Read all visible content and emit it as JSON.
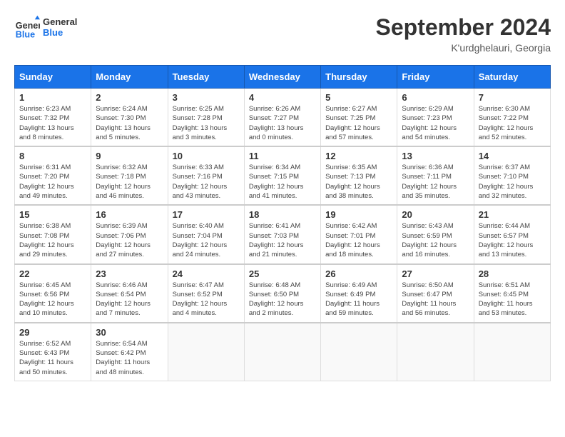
{
  "header": {
    "logo_line1": "General",
    "logo_line2": "Blue",
    "month": "September 2024",
    "location": "K'urdghelauri, Georgia"
  },
  "columns": [
    "Sunday",
    "Monday",
    "Tuesday",
    "Wednesday",
    "Thursday",
    "Friday",
    "Saturday"
  ],
  "weeks": [
    [
      {
        "day": "1",
        "info": "Sunrise: 6:23 AM\nSunset: 7:32 PM\nDaylight: 13 hours\nand 8 minutes."
      },
      {
        "day": "2",
        "info": "Sunrise: 6:24 AM\nSunset: 7:30 PM\nDaylight: 13 hours\nand 5 minutes."
      },
      {
        "day": "3",
        "info": "Sunrise: 6:25 AM\nSunset: 7:28 PM\nDaylight: 13 hours\nand 3 minutes."
      },
      {
        "day": "4",
        "info": "Sunrise: 6:26 AM\nSunset: 7:27 PM\nDaylight: 13 hours\nand 0 minutes."
      },
      {
        "day": "5",
        "info": "Sunrise: 6:27 AM\nSunset: 7:25 PM\nDaylight: 12 hours\nand 57 minutes."
      },
      {
        "day": "6",
        "info": "Sunrise: 6:29 AM\nSunset: 7:23 PM\nDaylight: 12 hours\nand 54 minutes."
      },
      {
        "day": "7",
        "info": "Sunrise: 6:30 AM\nSunset: 7:22 PM\nDaylight: 12 hours\nand 52 minutes."
      }
    ],
    [
      {
        "day": "8",
        "info": "Sunrise: 6:31 AM\nSunset: 7:20 PM\nDaylight: 12 hours\nand 49 minutes."
      },
      {
        "day": "9",
        "info": "Sunrise: 6:32 AM\nSunset: 7:18 PM\nDaylight: 12 hours\nand 46 minutes."
      },
      {
        "day": "10",
        "info": "Sunrise: 6:33 AM\nSunset: 7:16 PM\nDaylight: 12 hours\nand 43 minutes."
      },
      {
        "day": "11",
        "info": "Sunrise: 6:34 AM\nSunset: 7:15 PM\nDaylight: 12 hours\nand 41 minutes."
      },
      {
        "day": "12",
        "info": "Sunrise: 6:35 AM\nSunset: 7:13 PM\nDaylight: 12 hours\nand 38 minutes."
      },
      {
        "day": "13",
        "info": "Sunrise: 6:36 AM\nSunset: 7:11 PM\nDaylight: 12 hours\nand 35 minutes."
      },
      {
        "day": "14",
        "info": "Sunrise: 6:37 AM\nSunset: 7:10 PM\nDaylight: 12 hours\nand 32 minutes."
      }
    ],
    [
      {
        "day": "15",
        "info": "Sunrise: 6:38 AM\nSunset: 7:08 PM\nDaylight: 12 hours\nand 29 minutes."
      },
      {
        "day": "16",
        "info": "Sunrise: 6:39 AM\nSunset: 7:06 PM\nDaylight: 12 hours\nand 27 minutes."
      },
      {
        "day": "17",
        "info": "Sunrise: 6:40 AM\nSunset: 7:04 PM\nDaylight: 12 hours\nand 24 minutes."
      },
      {
        "day": "18",
        "info": "Sunrise: 6:41 AM\nSunset: 7:03 PM\nDaylight: 12 hours\nand 21 minutes."
      },
      {
        "day": "19",
        "info": "Sunrise: 6:42 AM\nSunset: 7:01 PM\nDaylight: 12 hours\nand 18 minutes."
      },
      {
        "day": "20",
        "info": "Sunrise: 6:43 AM\nSunset: 6:59 PM\nDaylight: 12 hours\nand 16 minutes."
      },
      {
        "day": "21",
        "info": "Sunrise: 6:44 AM\nSunset: 6:57 PM\nDaylight: 12 hours\nand 13 minutes."
      }
    ],
    [
      {
        "day": "22",
        "info": "Sunrise: 6:45 AM\nSunset: 6:56 PM\nDaylight: 12 hours\nand 10 minutes."
      },
      {
        "day": "23",
        "info": "Sunrise: 6:46 AM\nSunset: 6:54 PM\nDaylight: 12 hours\nand 7 minutes."
      },
      {
        "day": "24",
        "info": "Sunrise: 6:47 AM\nSunset: 6:52 PM\nDaylight: 12 hours\nand 4 minutes."
      },
      {
        "day": "25",
        "info": "Sunrise: 6:48 AM\nSunset: 6:50 PM\nDaylight: 12 hours\nand 2 minutes."
      },
      {
        "day": "26",
        "info": "Sunrise: 6:49 AM\nSunset: 6:49 PM\nDaylight: 11 hours\nand 59 minutes."
      },
      {
        "day": "27",
        "info": "Sunrise: 6:50 AM\nSunset: 6:47 PM\nDaylight: 11 hours\nand 56 minutes."
      },
      {
        "day": "28",
        "info": "Sunrise: 6:51 AM\nSunset: 6:45 PM\nDaylight: 11 hours\nand 53 minutes."
      }
    ],
    [
      {
        "day": "29",
        "info": "Sunrise: 6:52 AM\nSunset: 6:43 PM\nDaylight: 11 hours\nand 50 minutes."
      },
      {
        "day": "30",
        "info": "Sunrise: 6:54 AM\nSunset: 6:42 PM\nDaylight: 11 hours\nand 48 minutes."
      },
      {
        "day": "",
        "info": ""
      },
      {
        "day": "",
        "info": ""
      },
      {
        "day": "",
        "info": ""
      },
      {
        "day": "",
        "info": ""
      },
      {
        "day": "",
        "info": ""
      }
    ]
  ]
}
